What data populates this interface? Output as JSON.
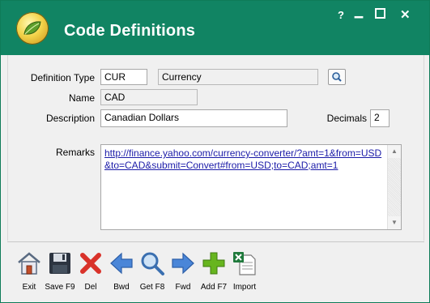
{
  "window": {
    "title": "Code Definitions",
    "controls": {
      "help": "?",
      "minimize": "▁",
      "maximize": "",
      "close": "✕"
    }
  },
  "form": {
    "definition_type": {
      "label": "Definition Type",
      "code": "CUR",
      "description": "Currency"
    },
    "name": {
      "label": "Name",
      "value": "CAD"
    },
    "description": {
      "label": "Description",
      "value": "Canadian Dollars"
    },
    "decimals": {
      "label": "Decimals",
      "value": "2"
    },
    "remarks": {
      "label": "Remarks",
      "value": "http://finance.yahoo.com/currency-converter/?amt=1&from=USD&to=CAD&submit=Convert#from=USD;to=CAD;amt=1"
    }
  },
  "toolbar": {
    "exit": "Exit",
    "save": "Save F9",
    "del": "Del",
    "bwd": "Bwd",
    "get": "Get F8",
    "fwd": "Fwd",
    "add": "Add F7",
    "import": "Import"
  },
  "colors": {
    "titlebar": "#118463",
    "link": "#1b1ba8",
    "delete_red": "#d9322a",
    "arrow_blue": "#4a86d8",
    "add_green": "#67b51f"
  }
}
